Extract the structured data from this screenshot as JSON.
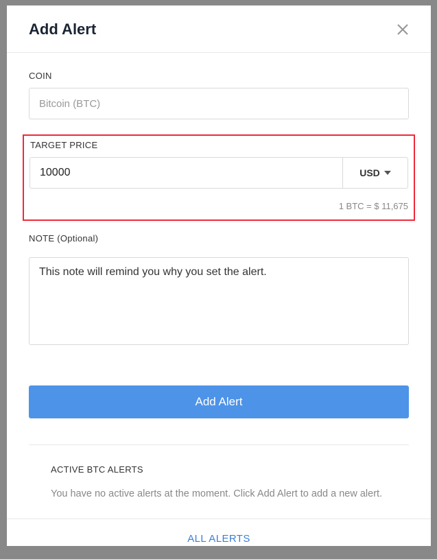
{
  "header": {
    "title": "Add Alert"
  },
  "coin": {
    "label": "COIN",
    "value": "Bitcoin (BTC)"
  },
  "target_price": {
    "label": "TARGET PRICE",
    "value": "10000",
    "currency": "USD",
    "rate": "1 BTC = $ 11,675"
  },
  "note": {
    "label": "NOTE (Optional)",
    "placeholder": "This note will remind you why you set the alert."
  },
  "buttons": {
    "add_alert": "Add Alert"
  },
  "active_alerts": {
    "title": "ACTIVE BTC ALERTS",
    "empty_text": "You have no active alerts at the moment. Click Add Alert to add a new alert."
  },
  "footer": {
    "all_alerts": "ALL ALERTS"
  }
}
